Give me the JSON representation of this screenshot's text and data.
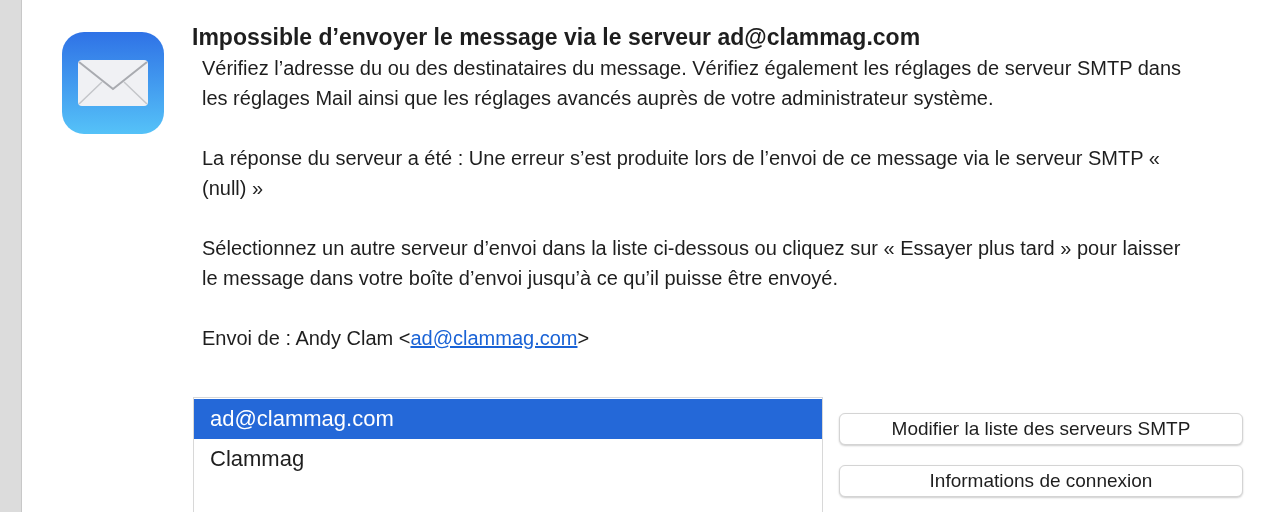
{
  "dialog": {
    "title": "Impossible d’envoyer le message via le serveur ad@clammag.com",
    "paragraphs": [
      "Vérifiez l’adresse du ou des destinataires du message. Vérifiez également les réglages de serveur SMTP dans les réglages Mail ainsi que les réglages avancés auprès de votre administrateur système.",
      "La réponse du serveur a été : Une erreur s’est produite lors de l’envoi de ce message via le serveur SMTP « (null) »",
      "Sélectionnez un autre serveur d’envoi dans la liste ci-dessous ou cliquez sur « Essayer plus tard » pour laisser le message dans votre boîte d’envoi jusqu’à ce qu’il puisse être envoyé."
    ],
    "sender": {
      "label": "Envoi de : Andy Clam  <",
      "email": "ad@clammag.com",
      "suffix": ">"
    },
    "servers": [
      {
        "name": "ad@clammag.com",
        "selected": true
      },
      {
        "name": "Clammag",
        "selected": false
      }
    ],
    "buttons": [
      "Modifier la liste des serveurs SMTP",
      "Informations de connexion"
    ]
  }
}
